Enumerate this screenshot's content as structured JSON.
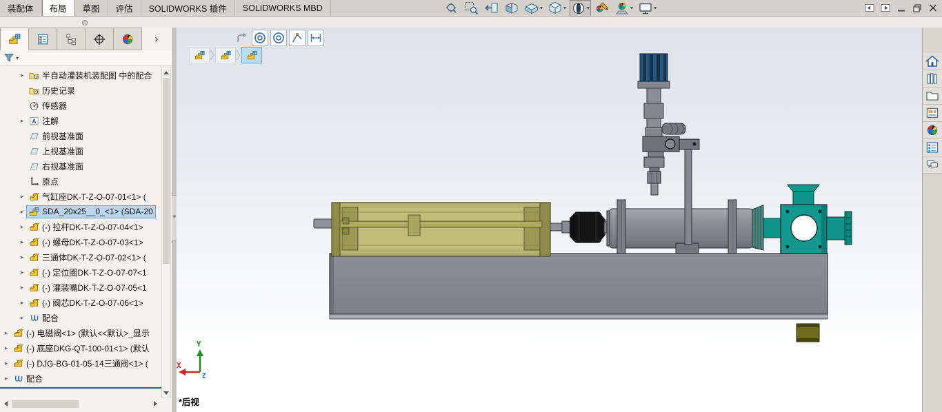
{
  "ribbon": {
    "tabs": [
      {
        "label": "装配体"
      },
      {
        "label": "布局",
        "active": true
      },
      {
        "label": "草图"
      },
      {
        "label": "评估"
      },
      {
        "label": "SOLIDWORKS 插件"
      },
      {
        "label": "SOLIDWORKS MBD"
      }
    ]
  },
  "heads_up_toolbar": {
    "buttons": [
      {
        "icon": "zoom-fit-icon"
      },
      {
        "icon": "zoom-area-icon"
      },
      {
        "icon": "previous-view-icon"
      },
      {
        "icon": "section-view-icon"
      },
      {
        "icon": "annotation-views-icon",
        "dropdown": true
      },
      {
        "icon": "view-orientation-icon",
        "dropdown": true
      },
      {
        "icon": "display-style-icon",
        "dropdown": true,
        "pressed": true
      },
      {
        "icon": "edit-appearance-icon"
      },
      {
        "icon": "apply-scene-icon",
        "dropdown": true
      },
      {
        "icon": "view-settings-icon",
        "dropdown": true
      }
    ]
  },
  "window_controls": {
    "buttons": [
      {
        "icon": "pane-collapse-left-icon"
      },
      {
        "icon": "pane-collapse-right-icon"
      },
      {
        "icon": "minimize-icon"
      },
      {
        "icon": "restore-icon"
      },
      {
        "icon": "close-icon"
      }
    ]
  },
  "feature_tree": {
    "manager_tabs": [
      {
        "icon": "featuremanager-icon",
        "active": true
      },
      {
        "icon": "propertymanager-icon"
      },
      {
        "icon": "configurationmanager-icon"
      },
      {
        "icon": "dimxpertmanager-icon"
      },
      {
        "icon": "displaymanager-icon"
      },
      {
        "icon": "tabs-expand-icon"
      }
    ],
    "filter": {
      "icon": "filter-funnel-icon"
    },
    "items": [
      {
        "label": "半自动灌装机装配图 中的配合",
        "icon": "mates-folder-icon",
        "indent": 1,
        "arrow": true
      },
      {
        "label": "历史记录",
        "icon": "history-folder-icon",
        "indent": 1,
        "arrow": false
      },
      {
        "label": "传感器",
        "icon": "sensors-icon",
        "indent": 1,
        "arrow": false
      },
      {
        "label": "注解",
        "icon": "annotations-icon",
        "indent": 1,
        "arrow": true
      },
      {
        "label": "前视基准面",
        "icon": "plane-icon",
        "indent": 1,
        "arrow": false
      },
      {
        "label": "上视基准面",
        "icon": "plane-icon",
        "indent": 1,
        "arrow": false
      },
      {
        "label": "右视基准面",
        "icon": "plane-icon",
        "indent": 1,
        "arrow": false
      },
      {
        "label": "原点",
        "icon": "origin-icon",
        "indent": 1,
        "arrow": false
      },
      {
        "label": "气缸座DK-T-Z-O-07-01<1> (",
        "icon": "part-icon",
        "indent": 1,
        "arrow": true
      },
      {
        "label": "SDA_20x25__0_<1> (SDA-20",
        "icon": "assembly-icon",
        "indent": 1,
        "arrow": true,
        "selected": true
      },
      {
        "label": "(-) 拉杆DK-T-Z-O-07-04<1>",
        "icon": "part-icon",
        "indent": 1,
        "arrow": true
      },
      {
        "label": "(-) 螺母DK-T-Z-O-07-03<1>",
        "icon": "part-icon",
        "indent": 1,
        "arrow": true
      },
      {
        "label": "三通体DK-T-Z-O-07-02<1> (",
        "icon": "part-icon",
        "indent": 1,
        "arrow": true
      },
      {
        "label": "(-) 定位圈DK-T-Z-O-07-07<1",
        "icon": "part-icon",
        "indent": 1,
        "arrow": true
      },
      {
        "label": "(-) 灌装嘴DK-T-Z-O-07-05<1",
        "icon": "part-icon",
        "indent": 1,
        "arrow": true
      },
      {
        "label": "(-) 阀芯DK-T-Z-O-07-06<1>",
        "icon": "part-icon",
        "indent": 1,
        "arrow": true
      },
      {
        "label": "配合",
        "icon": "mates-icon",
        "indent": 1,
        "arrow": true
      },
      {
        "label": "(-) 电磁阀<1> (默认<<默认>_显示",
        "icon": "part-icon",
        "indent": 0,
        "arrow": true
      },
      {
        "label": "(-) 底座DKG-QT-100-01<1> (默认",
        "icon": "part-icon",
        "indent": 0,
        "arrow": true
      },
      {
        "label": "(-) DJG-BG-01-05-14三通阀<1> (",
        "icon": "part-icon",
        "indent": 0,
        "arrow": true
      },
      {
        "label": "配合",
        "icon": "mates-icon",
        "indent": 0,
        "arrow": true
      }
    ]
  },
  "layout_toolbar": {
    "buttons": [
      {
        "icon": "exit-flag-icon",
        "frameless": true
      },
      {
        "icon": "concentric-circle-icon"
      },
      {
        "icon": "concentric-circle-icon"
      },
      {
        "icon": "sketch-line-icon"
      },
      {
        "icon": "horizontal-dimension-icon"
      }
    ]
  },
  "breadcrumb": {
    "items": [
      {
        "icon": "assembly-icon"
      },
      {
        "icon": "assembly-icon"
      },
      {
        "icon": "assembly-icon",
        "selected": true
      }
    ]
  },
  "task_pane": {
    "buttons": [
      {
        "icon": "home-icon"
      },
      {
        "icon": "design-library-icon"
      },
      {
        "icon": "file-explorer-icon"
      },
      {
        "icon": "view-palette-icon"
      },
      {
        "icon": "appearances-scenes-icon"
      },
      {
        "icon": "custom-properties-icon"
      },
      {
        "icon": "forum-icon"
      }
    ]
  },
  "viewport": {
    "view_label": "*后视",
    "triad": {
      "x": "X",
      "y": "Y",
      "z": "Z"
    },
    "selection_highlight": "#b9d5ef",
    "model_colors": {
      "base_gray": "#83868e",
      "air_cylinder_yellow": "#b2af68",
      "coupling_black": "#151515",
      "valve_teal": "#12988f",
      "foot_olive": "#6e6d1e",
      "knob_blue": "#27567f",
      "steel_gray": "#8b8e96"
    }
  }
}
